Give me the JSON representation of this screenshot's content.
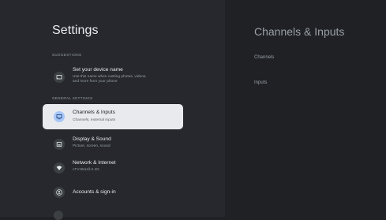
{
  "left": {
    "title": "Settings",
    "suggestions_label": "SUGGESTIONS",
    "suggestion": {
      "title": "Set your device name",
      "subtitle_line1": "Use this name when casting photos, videos,",
      "subtitle_line2": "and more from your phone"
    },
    "general_label": "GENERAL SETTINGS",
    "items": [
      {
        "title": "Channels & Inputs",
        "subtitle": "Channels, external inputs"
      },
      {
        "title": "Display & Sound",
        "subtitle": "Picture, screen, sound"
      },
      {
        "title": "Network & Internet",
        "subtitle": "cTV-Brazil-2.4G"
      },
      {
        "title": "Accounts & sign-in",
        "subtitle": ""
      }
    ]
  },
  "right": {
    "title": "Channels & Inputs",
    "items": [
      "Channels",
      "Inputs"
    ]
  },
  "colors": {
    "selected_bg": "#e8eaed",
    "selected_icon": "#a8c7fa",
    "panel_bg": "#26282d",
    "detail_bg": "#1f2125"
  }
}
